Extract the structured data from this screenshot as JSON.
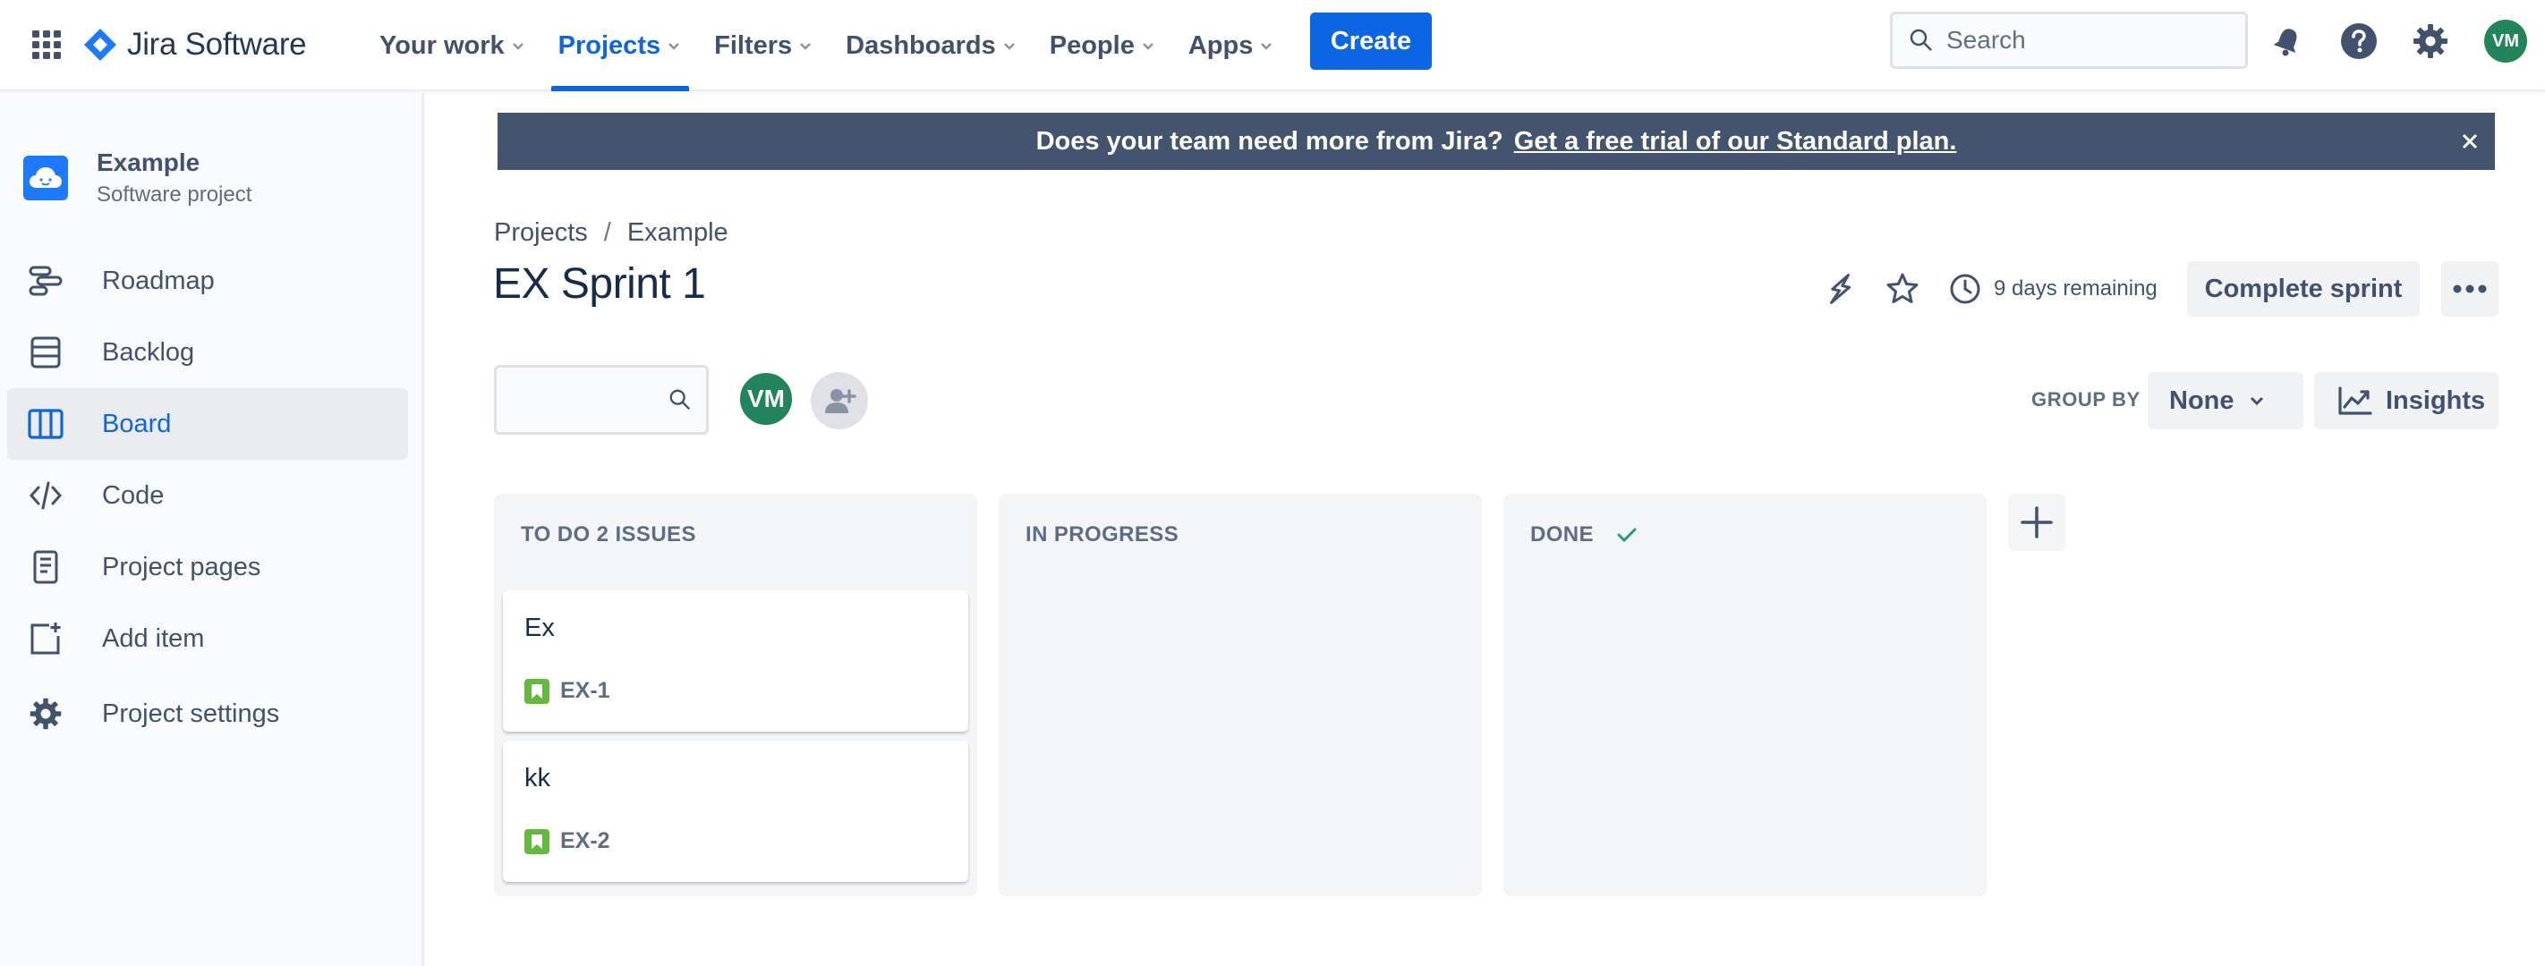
{
  "topnav": {
    "app_name": "Jira Software",
    "items": [
      {
        "label": "Your work"
      },
      {
        "label": "Projects"
      },
      {
        "label": "Filters"
      },
      {
        "label": "Dashboards"
      },
      {
        "label": "People"
      },
      {
        "label": "Apps"
      }
    ],
    "active_item": "Projects",
    "create_label": "Create",
    "search_placeholder": "Search",
    "user_initials": "VM",
    "icons": [
      "app-switcher-icon",
      "notifications-icon",
      "help-icon",
      "settings-icon"
    ]
  },
  "sidebar": {
    "project_name": "Example",
    "project_type": "Software project",
    "items": [
      {
        "label": "Roadmap",
        "icon": "roadmap-icon"
      },
      {
        "label": "Backlog",
        "icon": "backlog-icon"
      },
      {
        "label": "Board",
        "icon": "board-icon"
      },
      {
        "label": "Code",
        "icon": "code-icon"
      },
      {
        "label": "Project pages",
        "icon": "pages-icon"
      },
      {
        "label": "Add item",
        "icon": "add-item-icon"
      },
      {
        "label": "Project settings",
        "icon": "gear-icon"
      }
    ],
    "active_item": "Board"
  },
  "banner": {
    "text": "Does your team need more from Jira?",
    "link": "Get a free trial of our Standard plan."
  },
  "breadcrumb": [
    "Projects",
    "Example"
  ],
  "page": {
    "title": "EX Sprint 1",
    "days_remaining": "9 days remaining",
    "complete_sprint_label": "Complete sprint"
  },
  "toolbar": {
    "user_initials": "VM",
    "group_by_label": "GROUP BY",
    "group_by_value": "None",
    "insights_label": "Insights"
  },
  "columns": [
    {
      "title": "TO DO 2 ISSUES",
      "cards": [
        {
          "title": "Ex",
          "key": "EX-1"
        },
        {
          "title": "kk",
          "key": "EX-2"
        }
      ]
    },
    {
      "title": "IN PROGRESS",
      "cards": []
    },
    {
      "title": "DONE",
      "cards": [],
      "done": true
    }
  ],
  "colors": {
    "brand": "#0c66e4",
    "banner_bg": "#44546f",
    "avatar_green": "#22845a",
    "story_green": "#63ba3c"
  }
}
